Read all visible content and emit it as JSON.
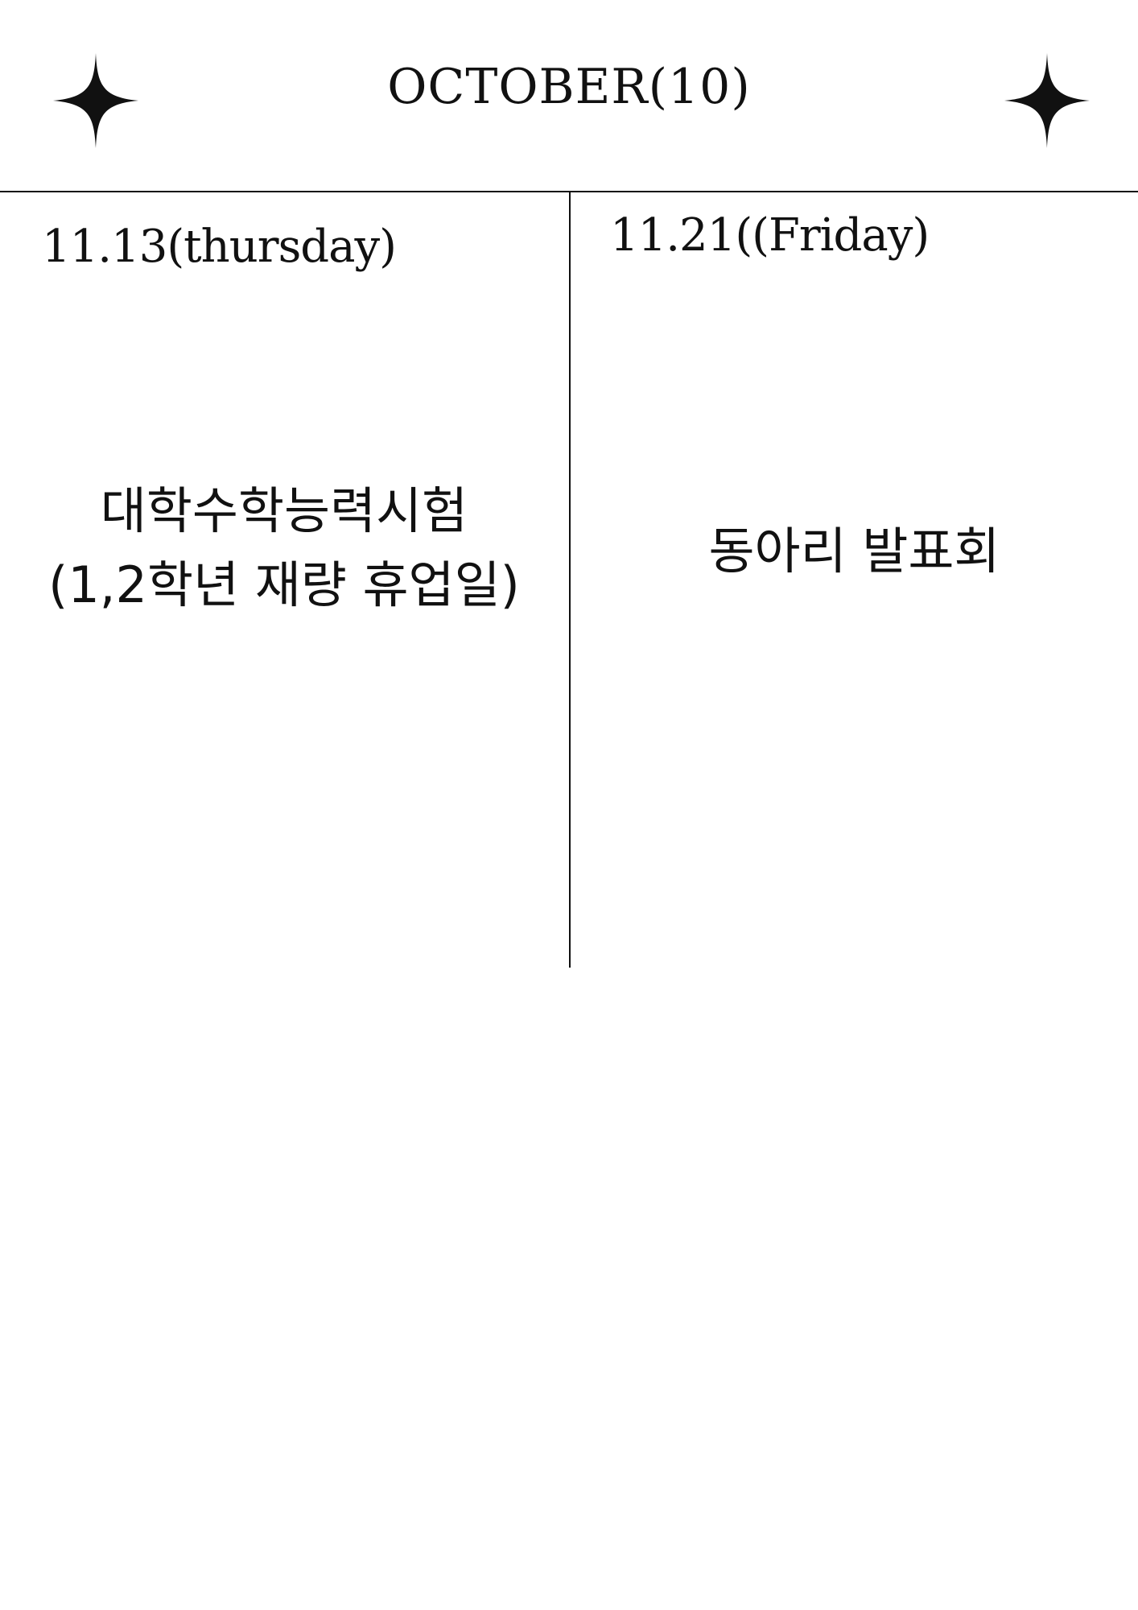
{
  "header": {
    "title": "OCTOBER(10)",
    "left_icon": "four-point-star-icon",
    "right_icon": "four-point-star-icon"
  },
  "days": [
    {
      "date": "11.13(thursday)",
      "event_lines": [
        "대학수학능력시험",
        "(1,2학년 재량 휴업일)"
      ]
    },
    {
      "date": "11.21((Friday)",
      "event_lines": [
        "동아리 발표회"
      ]
    }
  ],
  "colors": {
    "ink": "#111111",
    "background": "#ffffff"
  }
}
